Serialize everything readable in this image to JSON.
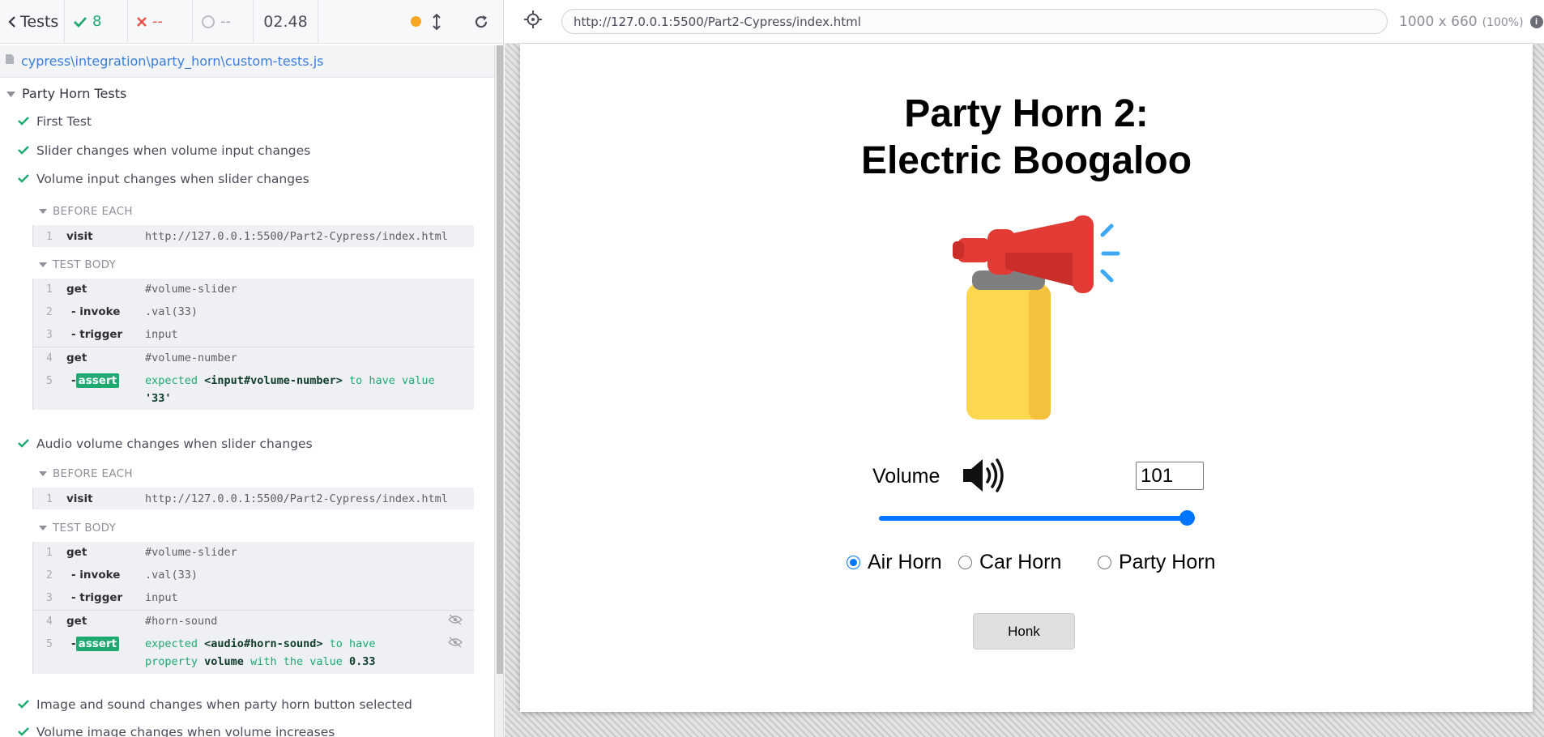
{
  "reporter": {
    "tests_label": "Tests",
    "passed": "8",
    "failed": "--",
    "pending": "--",
    "duration": "02.48",
    "spec_path": "cypress\\integration\\party_horn\\custom-tests.js",
    "suite_title": "Party Horn Tests",
    "tests": [
      {
        "title": "First Test"
      },
      {
        "title": "Slider changes when volume input changes"
      },
      {
        "title": "Volume input changes when slider changes"
      },
      {
        "title": "Audio volume changes when slider changes"
      },
      {
        "title": "Image and sound changes when party horn button selected"
      },
      {
        "title": "Volume image changes when volume increases"
      }
    ],
    "hooks": {
      "before_each": "BEFORE EACH",
      "test_body": "TEST BODY"
    },
    "test3": {
      "before": [
        {
          "num": "1",
          "name": "visit",
          "msg": "http://127.0.0.1:5500/Part2-Cypress/index.html"
        }
      ],
      "body": [
        {
          "num": "1",
          "name": "get",
          "msg": "#volume-slider"
        },
        {
          "num": "2",
          "name": "- invoke",
          "msg": ".val(33)"
        },
        {
          "num": "3",
          "name": "- trigger",
          "msg": "input"
        },
        {
          "num": "4",
          "name": "get",
          "msg": "#volume-number"
        },
        {
          "num": "5",
          "name": "assert",
          "prefix": "-",
          "msg1": "expected",
          "bold1": "<input#volume-number>",
          "msg2": "to have value",
          "line2": "'33'"
        }
      ]
    },
    "test4": {
      "before": [
        {
          "num": "1",
          "name": "visit",
          "msg": "http://127.0.0.1:5500/Part2-Cypress/index.html"
        }
      ],
      "body": [
        {
          "num": "1",
          "name": "get",
          "msg": "#volume-slider"
        },
        {
          "num": "2",
          "name": "- invoke",
          "msg": ".val(33)"
        },
        {
          "num": "3",
          "name": "- trigger",
          "msg": "input"
        },
        {
          "num": "4",
          "name": "get",
          "msg": "#horn-sound"
        },
        {
          "num": "5",
          "name": "assert",
          "prefix": "-",
          "msg1": "expected",
          "bold1": "<audio#horn-sound>",
          "msg2": "to have",
          "line2a": "property",
          "bold2": "volume",
          "line2b": "with the value",
          "bold3": "0.33"
        }
      ]
    }
  },
  "aut": {
    "url": "http://127.0.0.1:5500/Part2-Cypress/index.html",
    "viewport": "1000 x 660",
    "zoom": "(100%)",
    "title_line1": "Party Horn 2:",
    "title_line2": "Electric Boogaloo",
    "volume_label": "Volume",
    "volume_value": "101",
    "slider_value_fraction": 1.0,
    "radios": [
      {
        "label": "Air Horn",
        "checked": true
      },
      {
        "label": "Car Horn",
        "checked": false
      },
      {
        "label": "Party Horn",
        "checked": false
      }
    ],
    "honk_label": "Honk"
  },
  "colors": {
    "pass_green": "#1fa971",
    "fail_red": "#e4554f",
    "link_blue": "#3b7ed8",
    "accent_blue": "#0075ff",
    "running_orange": "#f5a623"
  }
}
